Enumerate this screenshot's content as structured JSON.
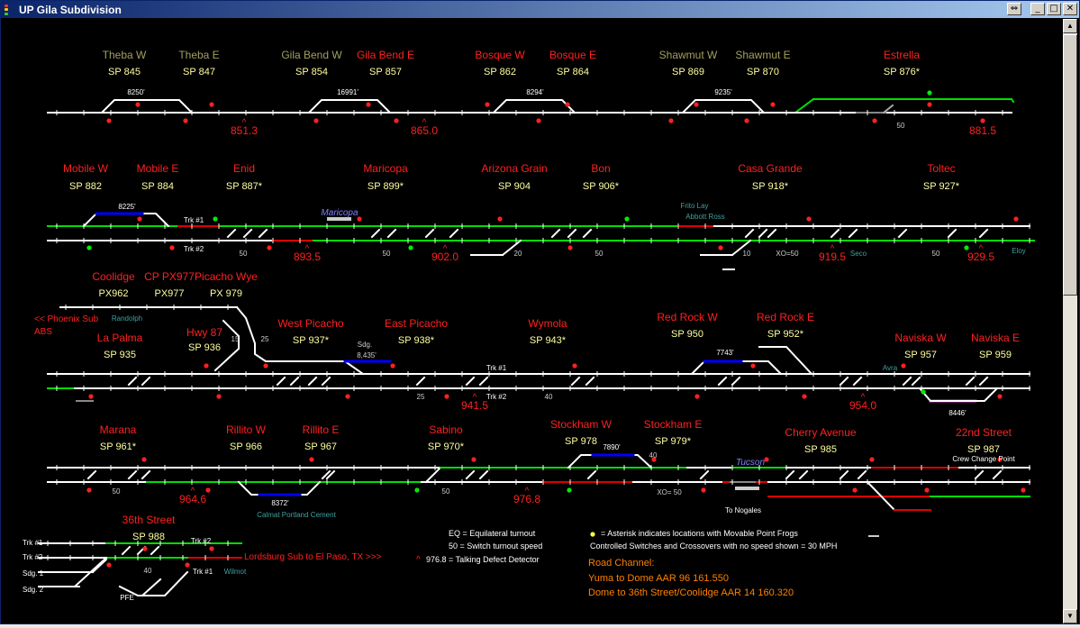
{
  "window": {
    "title": "UP Gila Subdivision"
  },
  "titlebar_buttons": {
    "resize": "⇔",
    "minimize": "_",
    "maximize": "□",
    "close": "✕"
  },
  "scrollbar": {
    "up": "▲",
    "down": "▼"
  },
  "colors": {
    "bg": "#000000",
    "track": "#ffffff",
    "route": "#00dd00",
    "occupied": "#dd0000",
    "siding": "#0000ff",
    "label_red": "#ff2020",
    "label_olive": "#a0a060",
    "sp": "#ffffa0",
    "teal": "#40a0a0",
    "orange": "#ff8000",
    "magenta": "#cc33cc"
  },
  "rows": {
    "r1": {
      "stations": [
        {
          "name": "Theba W",
          "sp": "SP 845",
          "color": "olive"
        },
        {
          "name": "Theba E",
          "sp": "SP 847",
          "color": "olive"
        },
        {
          "name": "Gila Bend W",
          "sp": "SP 854",
          "color": "olive"
        },
        {
          "name": "Gila Bend E",
          "sp": "SP 857",
          "color": "red"
        },
        {
          "name": "Bosque W",
          "sp": "SP 862",
          "color": "red"
        },
        {
          "name": "Bosque E",
          "sp": "SP 864",
          "color": "red"
        },
        {
          "name": "Shawmut W",
          "sp": "SP 869",
          "color": "olive"
        },
        {
          "name": "Shawmut E",
          "sp": "SP 870",
          "color": "olive"
        },
        {
          "name": "Estrella",
          "sp": "SP 876*",
          "color": "red"
        }
      ],
      "sidings": [
        "8250'",
        "16991'",
        "8294'",
        "9235'"
      ],
      "mileposts": [
        "851.3",
        "865.0",
        "881.5"
      ],
      "speeds": [
        "50"
      ]
    },
    "r2": {
      "stations": [
        {
          "name": "Mobile W",
          "sp": "SP 882",
          "color": "red"
        },
        {
          "name": "Mobile E",
          "sp": "SP 884",
          "color": "red"
        },
        {
          "name": "Enid",
          "sp": "SP 887*",
          "color": "red"
        },
        {
          "name": "Maricopa",
          "sp": "SP 899*",
          "color": "red"
        },
        {
          "name": "Arizona Grain",
          "sp": "SP 904",
          "color": "red"
        },
        {
          "name": "Bon",
          "sp": "SP 906*",
          "color": "red"
        },
        {
          "name": "Casa Grande",
          "sp": "SP 918*",
          "color": "red"
        },
        {
          "name": "Toltec",
          "sp": "SP 927*",
          "color": "red"
        }
      ],
      "siding": "8225'",
      "trk1": "Trk #1",
      "trk2": "Trk #2",
      "platform": "Maricopa",
      "industries": [
        "Frito Lay",
        "Abbott Ross",
        "Seco",
        "Eloy"
      ],
      "mileposts": [
        "893.5",
        "902.0",
        "919.5",
        "929.5"
      ],
      "speeds": [
        "50",
        "50",
        "20",
        "50",
        "10",
        "XO=50",
        "50"
      ]
    },
    "r3": {
      "upper": [
        {
          "name": "Coolidge",
          "sp": "PX962"
        },
        {
          "name": "CP PX977",
          "sp": "PX977"
        },
        {
          "name": "Picacho Wye",
          "sp": "PX 979"
        }
      ],
      "phoenix": "<< Phoenix Sub",
      "abs": "ABS",
      "randolph": "Randolph",
      "stations": [
        {
          "name": "La Palma",
          "sp": "SP 935"
        },
        {
          "name": "Hwy 87",
          "sp": "SP 936"
        },
        {
          "name": "West Picacho",
          "sp": "SP 937*"
        },
        {
          "name": "East Picacho",
          "sp": "SP 938*"
        },
        {
          "name": "Wymola",
          "sp": "SP 943*"
        },
        {
          "name": "Red Rock W",
          "sp": "SP 950"
        },
        {
          "name": "Red Rock E",
          "sp": "SP 952*"
        },
        {
          "name": "Naviska W",
          "sp": "SP 957"
        },
        {
          "name": "Naviska E",
          "sp": "SP 959"
        }
      ],
      "sdg": "Sdg.",
      "sdg_len": "8,435'",
      "siding_rr": "7743'",
      "siding_nv": "8446'",
      "avra": "Avra",
      "trk1": "Trk #1",
      "trk2": "Trk #2",
      "speeds": [
        "15",
        "25",
        "25",
        "40"
      ],
      "mileposts": [
        "941.5",
        "954.0"
      ]
    },
    "r4": {
      "stations": [
        {
          "name": "Marana",
          "sp": "SP 961*"
        },
        {
          "name": "Rillito W",
          "sp": "SP 966"
        },
        {
          "name": "Rillito E",
          "sp": "SP 967"
        },
        {
          "name": "Sabino",
          "sp": "SP 970*"
        },
        {
          "name": "Stockham W",
          "sp": "SP 978"
        },
        {
          "name": "Stockham E",
          "sp": "SP 979*"
        },
        {
          "name": "Cherry Avenue",
          "sp": "SP 985"
        },
        {
          "name": "22nd Street",
          "sp": "SP 987"
        }
      ],
      "siding_rw": "8372'",
      "siding_st": "7890'",
      "calmat": "Calmat Portland Cement",
      "tucson": "Tucson",
      "crew": "Crew Change Point",
      "nogales": "To Nogales",
      "xo": "XO= 50",
      "speeds": [
        "50",
        "50",
        "40"
      ],
      "mileposts": [
        "964.6",
        "976.8"
      ]
    },
    "r5": {
      "station": {
        "name": "36th Street",
        "sp": "SP 988"
      },
      "track_labels": [
        "Trk #1",
        "Trk #2",
        "Sdg. 1",
        "Sdg. 2"
      ],
      "trk2": "Trk #2",
      "trk1": "Trk #1",
      "wilmot": "Wilmot",
      "pfe": "PFE",
      "speed": "40",
      "lordsburg": "Lordsburg Sub to El Paso, TX >>>"
    }
  },
  "legend": {
    "eq": "EQ  = Equilateral turnout",
    "speed": "50  = Switch turnout speed",
    "caret": "^",
    "defect": "976.8   = Talking Defect Detector",
    "asterisk": "= Asterisk indicates locations with Movable Point Frogs",
    "controlled": "Controlled Switches and Crossovers with no speed shown = 30 MPH"
  },
  "road_channel": {
    "title": "Road Channel:",
    "line1": "Yuma to Dome AAR 96  161.550",
    "line2": "Dome to 36th Street/Coolidge AAR 14 160.320"
  }
}
